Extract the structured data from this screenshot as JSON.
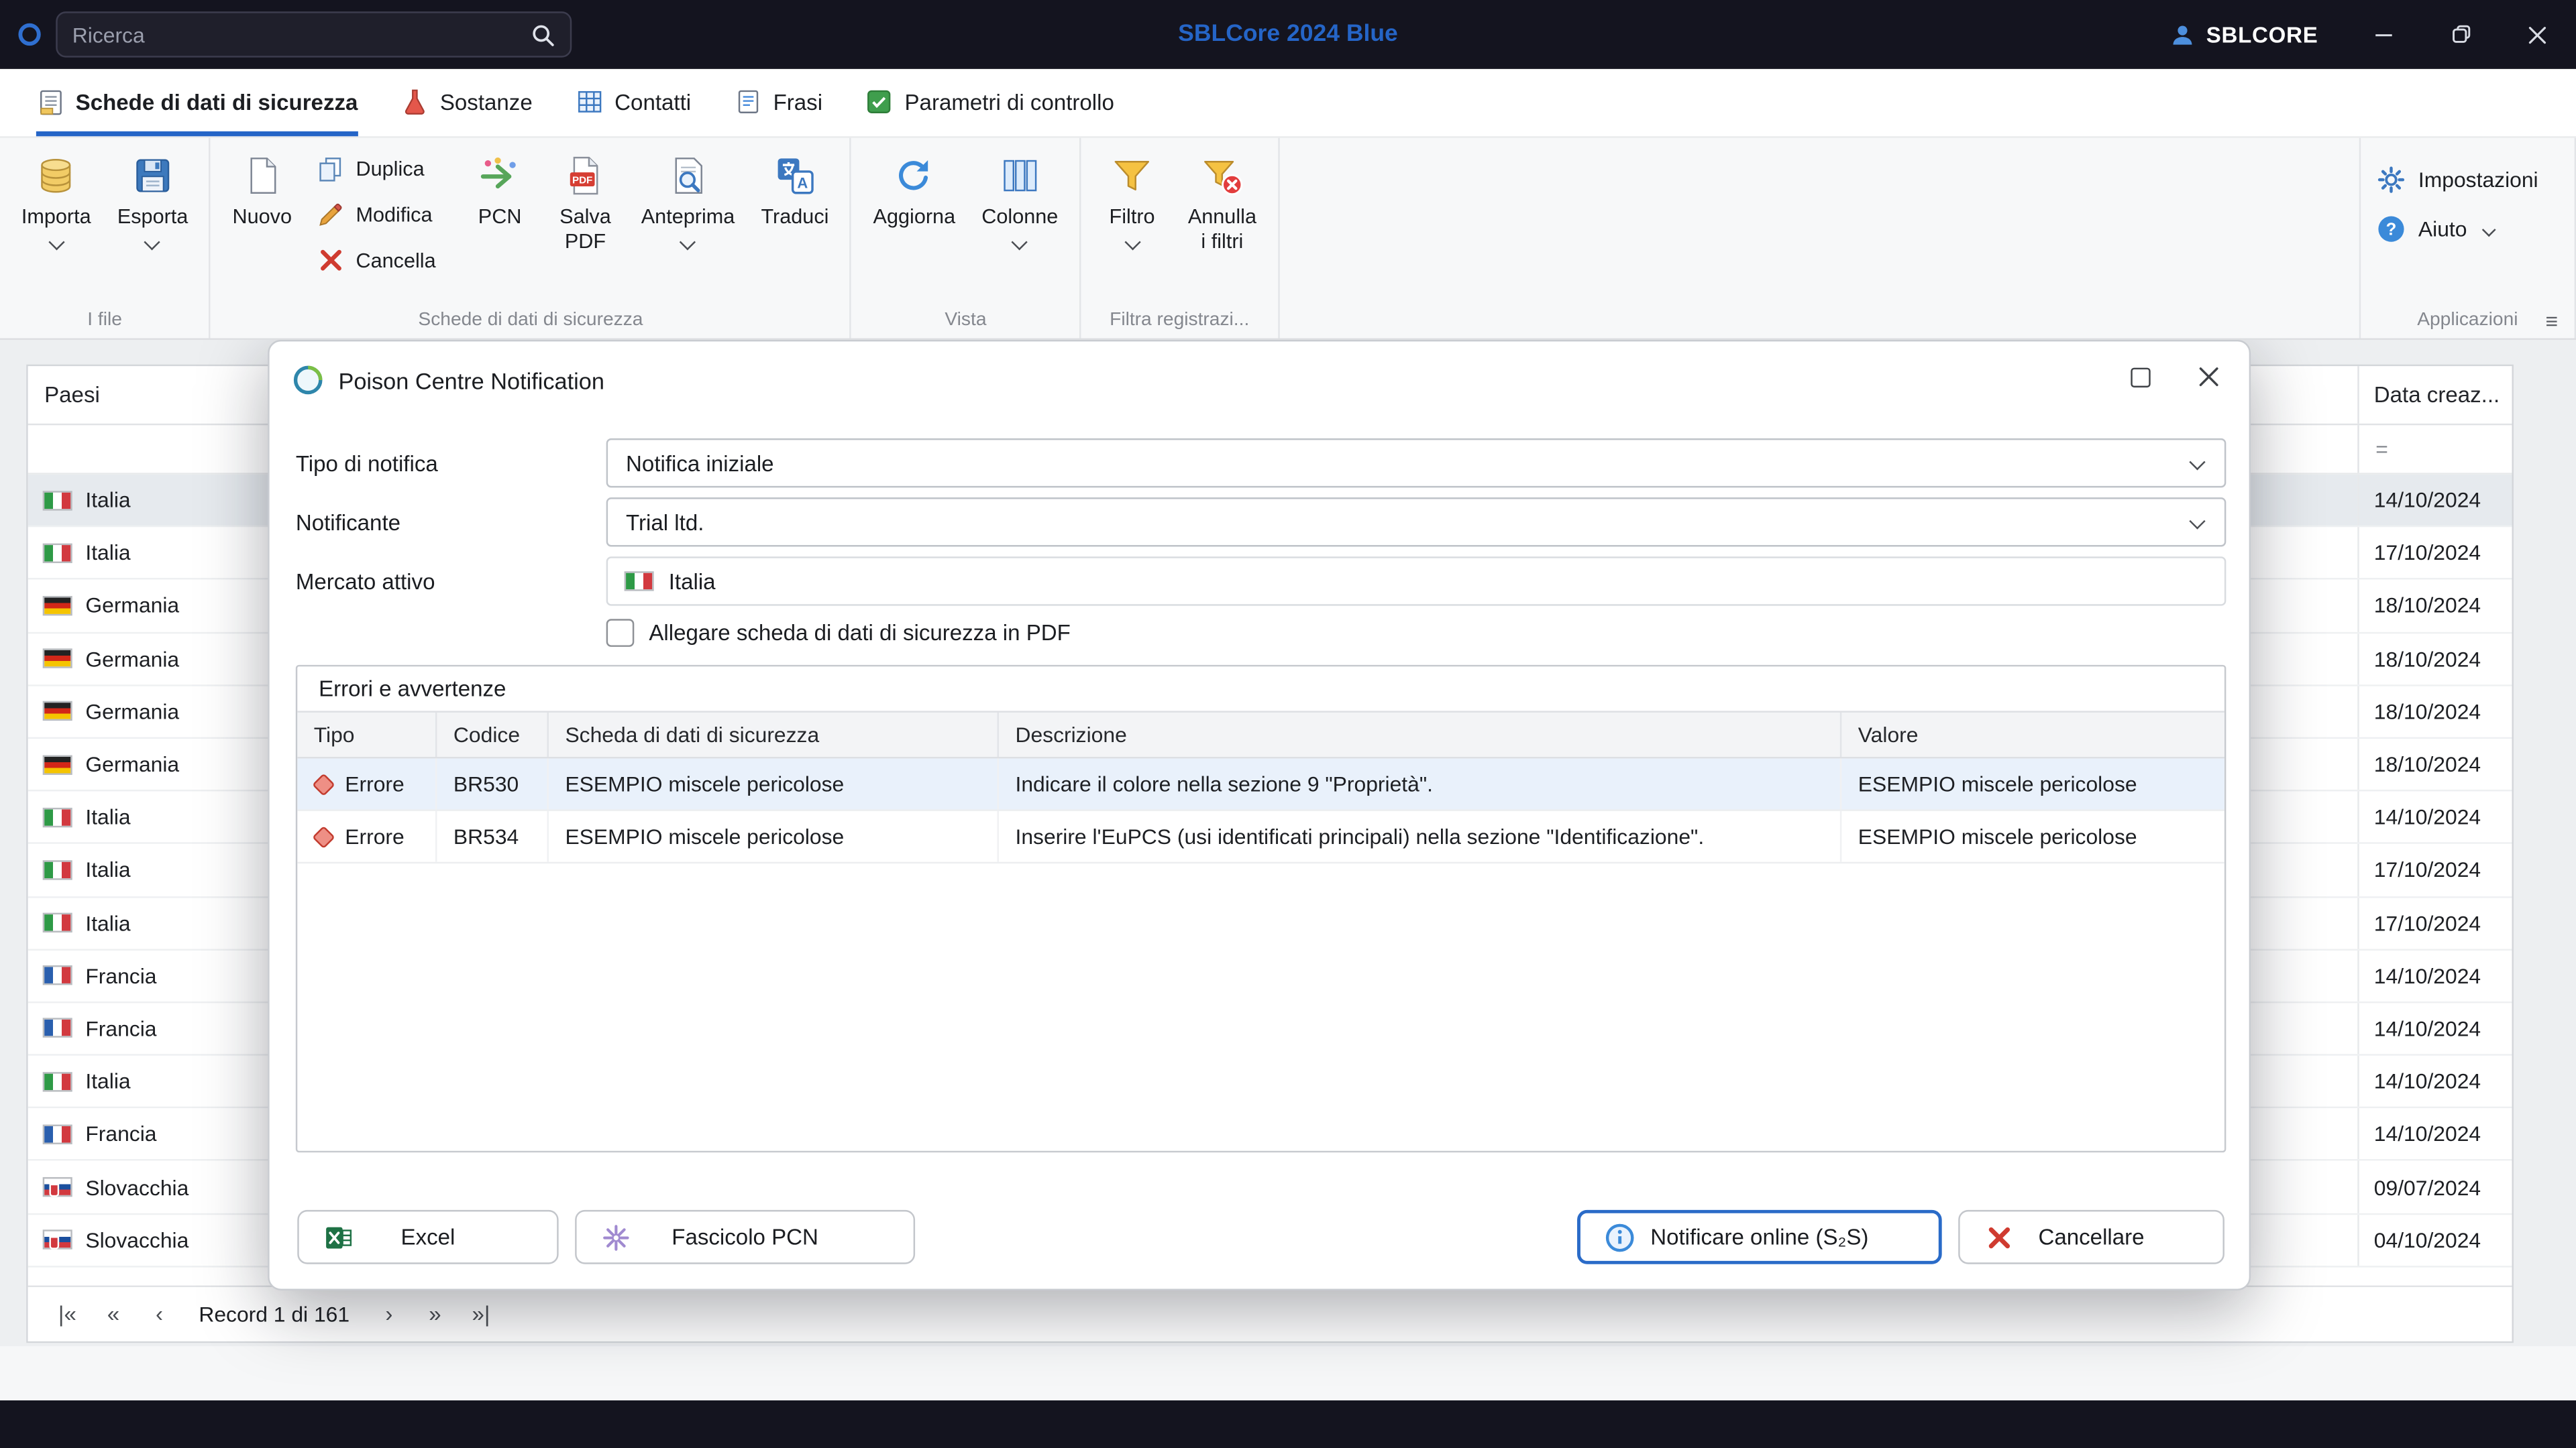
{
  "titlebar": {
    "search_placeholder": "Ricerca",
    "app_title": "SBLCore 2024 Blue",
    "user_label": "SBLCORE"
  },
  "tabs": [
    {
      "id": "schede-di-dati-di-sicurezza",
      "label": "Schede di dati di sicurezza",
      "icon": "sds-tab-icon",
      "active": true
    },
    {
      "id": "sostanze",
      "label": "Sostanze",
      "icon": "flask-icon",
      "active": false
    },
    {
      "id": "contatti",
      "label": "Contatti",
      "icon": "contacts-grid-icon",
      "active": false
    },
    {
      "id": "frasi",
      "label": "Frasi",
      "icon": "phrases-doc-icon",
      "active": false
    },
    {
      "id": "parametri-di-controllo",
      "label": "Parametri di controllo",
      "icon": "control-params-icon",
      "active": false
    }
  ],
  "ribbon": {
    "groups": [
      {
        "label": "I file",
        "items": [
          {
            "kind": "large",
            "id": "importa",
            "label": "Importa",
            "icon": "database-import-icon",
            "dropdown": true
          },
          {
            "kind": "large",
            "id": "esporta",
            "label": "Esporta",
            "icon": "save-export-icon",
            "dropdown": true
          }
        ]
      },
      {
        "label": "Schede di dati di sicurezza",
        "items": [
          {
            "kind": "large",
            "id": "nuovo",
            "label": "Nuovo",
            "icon": "new-document-icon",
            "dropdown": false
          },
          {
            "kind": "stack",
            "items": [
              {
                "id": "duplica",
                "label": "Duplica",
                "icon": "duplicate-icon"
              },
              {
                "id": "modifica",
                "label": "Modifica",
                "icon": "edit-pencil-icon"
              },
              {
                "id": "cancella",
                "label": "Cancella",
                "icon": "delete-x-icon"
              }
            ]
          },
          {
            "kind": "large",
            "id": "pcn",
            "label": "PCN",
            "icon": "pcn-arrow-icon",
            "dropdown": false
          },
          {
            "kind": "large",
            "id": "salva-pdf",
            "label": "Salva\nPDF",
            "icon": "pdf-save-icon",
            "dropdown": false
          },
          {
            "kind": "large",
            "id": "anteprima",
            "label": "Anteprima",
            "icon": "preview-icon",
            "dropdown": true
          },
          {
            "kind": "large",
            "id": "traduci",
            "label": "Traduci",
            "icon": "translate-icon",
            "dropdown": false
          }
        ]
      },
      {
        "label": "Vista",
        "items": [
          {
            "kind": "large",
            "id": "aggiorna",
            "label": "Aggiorna",
            "icon": "refresh-icon",
            "dropdown": false
          },
          {
            "kind": "large",
            "id": "colonne",
            "label": "Colonne",
            "icon": "columns-icon",
            "dropdown": true
          }
        ]
      },
      {
        "label": "Filtra registrazi...",
        "items": [
          {
            "kind": "large",
            "id": "filtro",
            "label": "Filtro",
            "icon": "filter-funnel-icon",
            "dropdown": true
          },
          {
            "kind": "large",
            "id": "annulla-i-filtri",
            "label": "Annulla\ni filtri",
            "icon": "clear-filter-icon",
            "dropdown": false
          }
        ]
      }
    ],
    "right": {
      "settings_label": "Impostazioni",
      "help_label": "Aiuto",
      "group_label": "Applicazioni"
    }
  },
  "table": {
    "country_header": "Paesi",
    "date_header": "Data creaz...",
    "filter_operator": "=",
    "rows": [
      {
        "country": "Italia",
        "flag": "it",
        "date": "14/10/2024",
        "selected": true
      },
      {
        "country": "Italia",
        "flag": "it",
        "date": "17/10/2024",
        "selected": false
      },
      {
        "country": "Germania",
        "flag": "de",
        "date": "18/10/2024",
        "selected": false
      },
      {
        "country": "Germania",
        "flag": "de",
        "date": "18/10/2024",
        "selected": false
      },
      {
        "country": "Germania",
        "flag": "de",
        "date": "18/10/2024",
        "selected": false
      },
      {
        "country": "Germania",
        "flag": "de",
        "date": "18/10/2024",
        "selected": false
      },
      {
        "country": "Italia",
        "flag": "it",
        "date": "14/10/2024",
        "selected": false
      },
      {
        "country": "Italia",
        "flag": "it",
        "date": "17/10/2024",
        "selected": false
      },
      {
        "country": "Italia",
        "flag": "it",
        "date": "17/10/2024",
        "selected": false
      },
      {
        "country": "Francia",
        "flag": "fr",
        "date": "14/10/2024",
        "selected": false
      },
      {
        "country": "Francia",
        "flag": "fr",
        "date": "14/10/2024",
        "selected": false
      },
      {
        "country": "Italia",
        "flag": "it",
        "date": "14/10/2024",
        "selected": false
      },
      {
        "country": "Francia",
        "flag": "fr",
        "date": "14/10/2024",
        "selected": false
      },
      {
        "country": "Slovacchia",
        "flag": "sk",
        "date": "09/07/2024",
        "selected": false
      },
      {
        "country": "Slovacchia",
        "flag": "sk",
        "date": "04/10/2024",
        "selected": false
      }
    ],
    "record_status": "Record 1 di 161",
    "nav_left": [
      {
        "id": "first",
        "glyph": "|«"
      },
      {
        "id": "fast-prev",
        "glyph": "«"
      },
      {
        "id": "prev",
        "glyph": "‹"
      }
    ],
    "nav_right": [
      {
        "id": "next",
        "glyph": "›"
      },
      {
        "id": "fast-next",
        "glyph": "»"
      },
      {
        "id": "last",
        "glyph": "»|"
      }
    ]
  },
  "dialog": {
    "title": "Poison Centre Notification",
    "fields": [
      {
        "label": "Tipo di notifica",
        "value": "Notifica iniziale"
      },
      {
        "label": "Notificante",
        "value": "Trial ltd."
      },
      {
        "label": "Mercato attivo",
        "value": "Italia",
        "flag": "it"
      }
    ],
    "checkbox_label": "Allegare scheda di dati di sicurezza in PDF",
    "checkbox_checked": false,
    "errors_group_title": "Errori e avvertenze",
    "errors_headers": [
      "Tipo",
      "Codice",
      "Scheda di dati di sicurezza",
      "Descrizione",
      "Valore"
    ],
    "errors_rows": [
      {
        "tipo": "Errore",
        "codice": "BR530",
        "scheda": "ESEMPIO miscele pericolose",
        "descrizione": "Indicare il colore nella sezione 9 \"Proprietà\".",
        "valore": "ESEMPIO miscele pericolose",
        "selected": true
      },
      {
        "tipo": "Errore",
        "codice": "BR534",
        "scheda": "ESEMPIO miscele pericolose",
        "descrizione": "Inserire l'EuPCS (usi identificati principali) nella sezione \"Identificazione\".",
        "valore": "ESEMPIO miscele pericolose",
        "selected": false
      }
    ],
    "buttons": {
      "excel": "Excel",
      "fascicolo_pcn": "Fascicolo PCN",
      "notify_online": "Notificare online (S₂S)",
      "cancel": "Cancellare"
    }
  },
  "colors": {
    "accent_blue": "#2a6bc8",
    "titlebar_bg": "#14141f",
    "error_red": "#cf3b30",
    "selected_row": "#e6eaee",
    "selected_error_row": "#e9f1fb"
  }
}
